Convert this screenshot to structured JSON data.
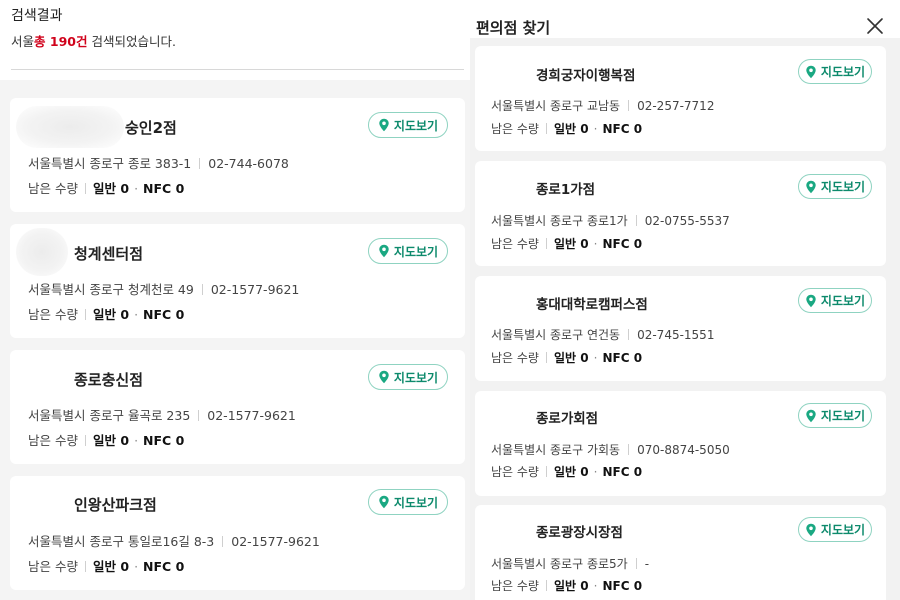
{
  "left": {
    "title": "검색결과",
    "summary_prefix": "서울",
    "summary_highlight": "총 190건",
    "summary_suffix": " 검색되었습니다.",
    "stock_label": "남은 수량",
    "general_label": "일반",
    "nfc_label": "NFC",
    "map_button": "지도보기",
    "stores": [
      {
        "name": "숭인2점",
        "address": "서울특별시 종로구 종로 383-1",
        "phone": "02-744-6078",
        "general": "0",
        "nfc": "0"
      },
      {
        "name": "청계센터점",
        "address": "서울특별시 종로구 청계천로 49",
        "phone": "02-1577-9621",
        "general": "0",
        "nfc": "0"
      },
      {
        "name": "종로충신점",
        "address": "서울특별시 종로구 율곡로 235",
        "phone": "02-1577-9621",
        "general": "0",
        "nfc": "0"
      },
      {
        "name": "인왕산파크점",
        "address": "서울특별시 종로구 통일로16길 8-3",
        "phone": "02-1577-9621",
        "general": "0",
        "nfc": "0"
      }
    ]
  },
  "right": {
    "title": "편의점 찾기",
    "close_icon": "close-icon",
    "stock_label": "남은 수량",
    "general_label": "일반",
    "nfc_label": "NFC",
    "map_button": "지도보기",
    "stores": [
      {
        "name": "경희궁자이행복점",
        "address": "서울특별시 종로구 교남동",
        "phone": "02-257-7712",
        "general": "0",
        "nfc": "0"
      },
      {
        "name": "종로1가점",
        "address": "서울특별시 종로구 종로1가",
        "phone": "02-0755-5537",
        "general": "0",
        "nfc": "0"
      },
      {
        "name": "홍대대학로캠퍼스점",
        "address": "서울특별시 종로구 연건동",
        "phone": "02-745-1551",
        "general": "0",
        "nfc": "0"
      },
      {
        "name": "종로가회점",
        "address": "서울특별시 종로구 가회동",
        "phone": "070-8874-5050",
        "general": "0",
        "nfc": "0"
      },
      {
        "name": "종로광장시장점",
        "address": "서울특별시 종로구 종로5가",
        "phone": "-",
        "general": "0",
        "nfc": "0"
      }
    ]
  },
  "colors": {
    "highlight": "#d0021b",
    "map_button_text": "#0d8a6c",
    "map_button_border": "#8fd3c1"
  }
}
